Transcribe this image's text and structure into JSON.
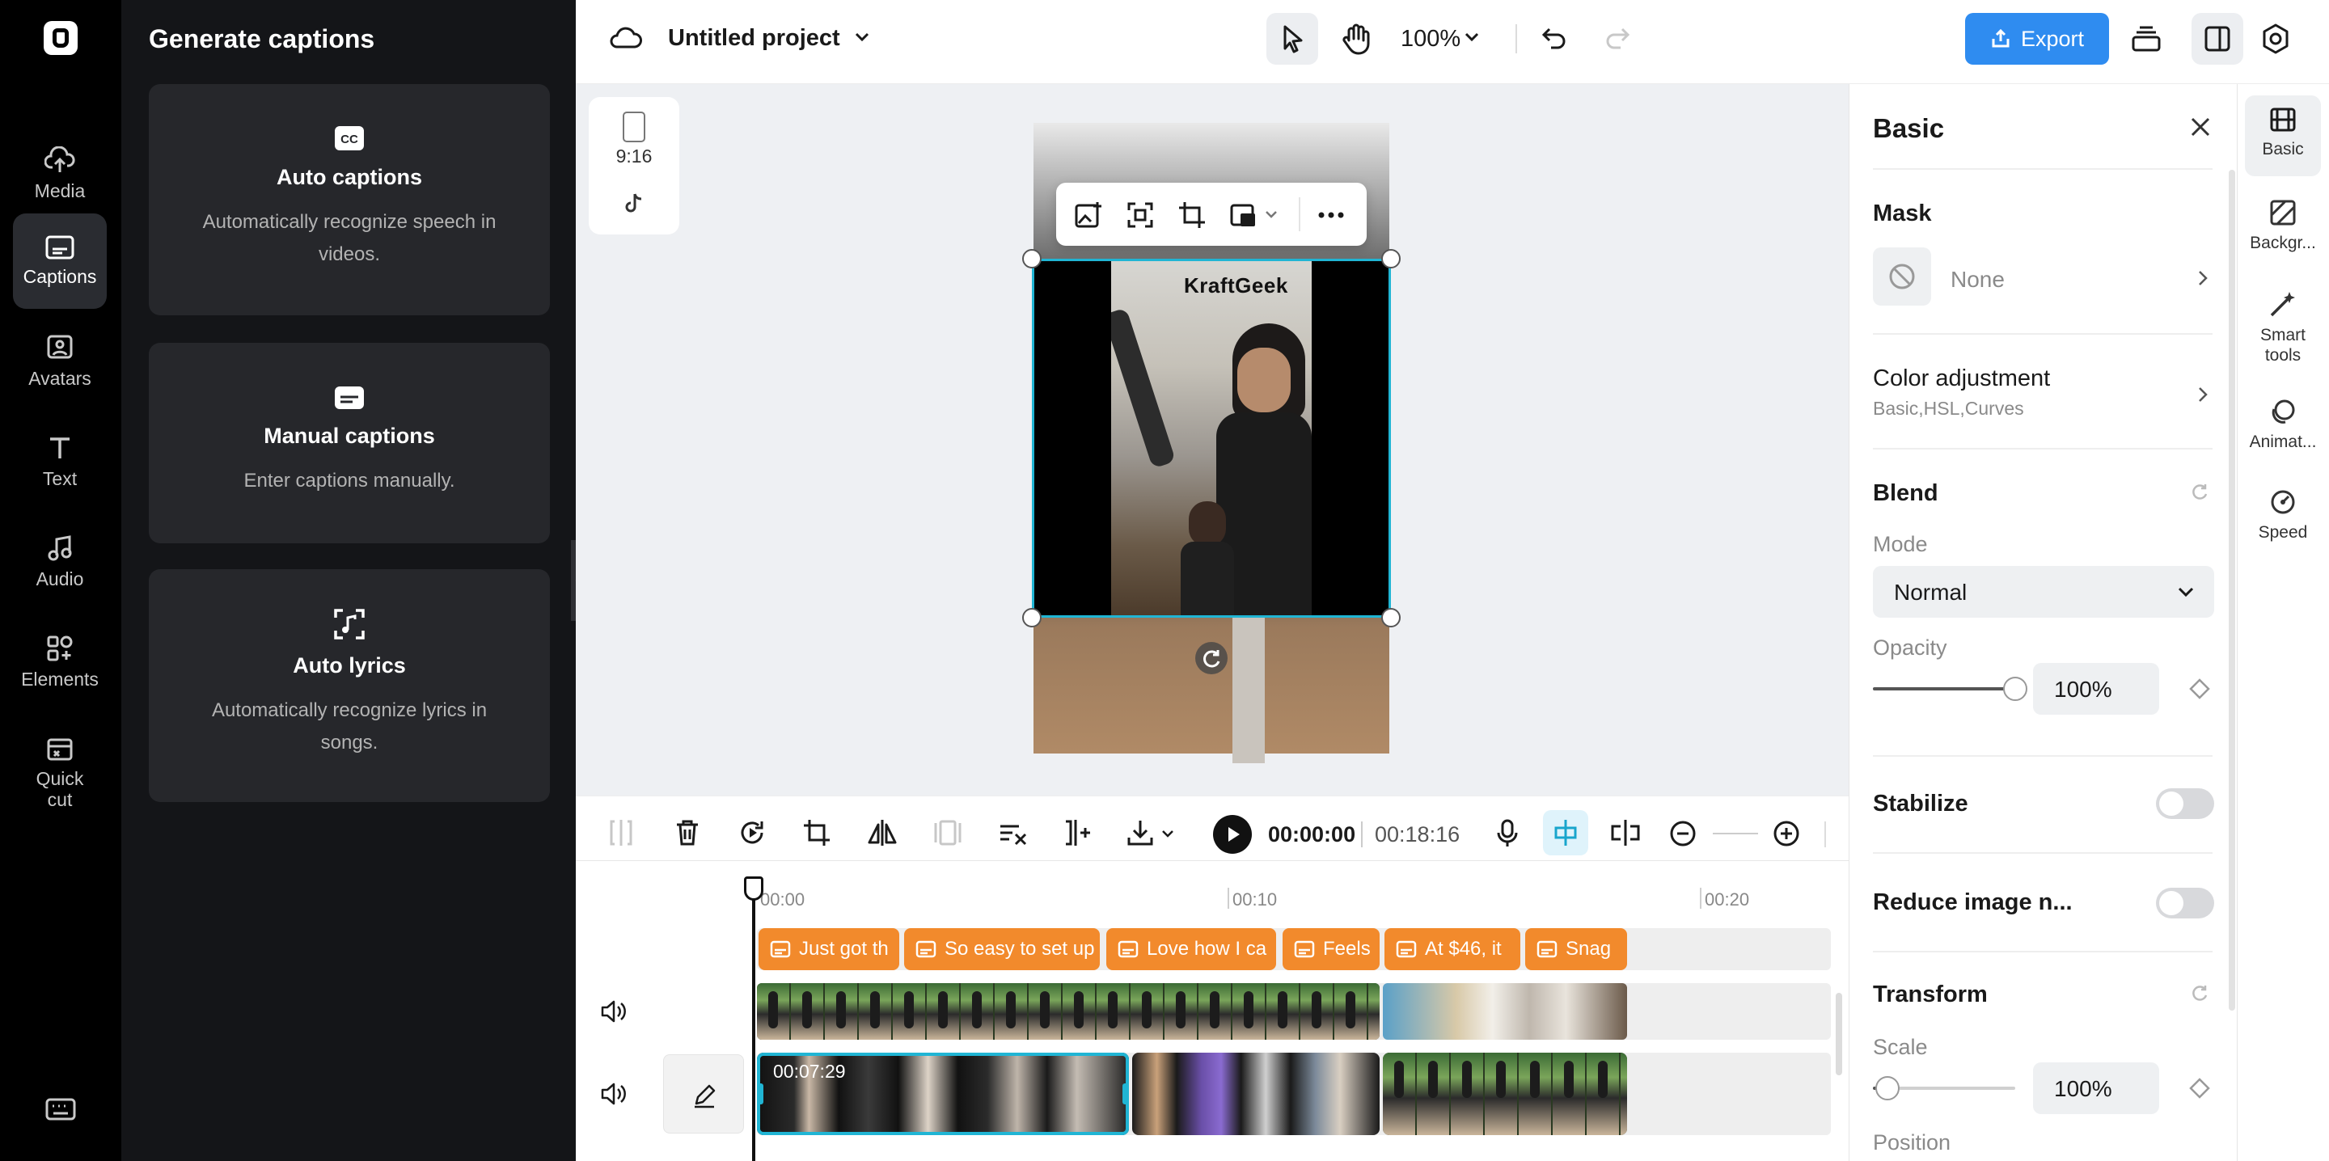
{
  "app": {
    "project_title": "Untitled project",
    "zoom": "100%",
    "export_label": "Export"
  },
  "rail": {
    "items": [
      {
        "label": "Media",
        "icon": "cloud-upload-icon"
      },
      {
        "label": "Captions",
        "icon": "captions-icon",
        "active": true
      },
      {
        "label": "Avatars",
        "icon": "avatar-icon"
      },
      {
        "label": "Text",
        "icon": "text-icon"
      },
      {
        "label": "Audio",
        "icon": "music-icon"
      },
      {
        "label": "Elements",
        "icon": "elements-icon"
      },
      {
        "label": "Quick cut",
        "icon": "quick-cut-icon"
      }
    ]
  },
  "panel": {
    "title": "Generate captions",
    "cards": [
      {
        "title": "Auto captions",
        "desc": "Automatically recognize speech in videos.",
        "icon": "cc-icon"
      },
      {
        "title": "Manual captions",
        "desc": "Enter captions manually.",
        "icon": "subtitle-icon"
      },
      {
        "title": "Auto lyrics",
        "desc": "Automatically recognize lyrics in songs.",
        "icon": "lyrics-icon"
      }
    ]
  },
  "canvas": {
    "ratio_label": "9:16",
    "watermark": "KraftGeek"
  },
  "right_panel": {
    "title": "Basic",
    "mask": {
      "label": "Mask",
      "value": "None"
    },
    "color_adjustment": {
      "label": "Color adjustment",
      "sub": "Basic,HSL,Curves"
    },
    "blend": {
      "label": "Blend",
      "mode_label": "Mode",
      "mode_value": "Normal",
      "opacity_label": "Opacity",
      "opacity_value": "100%",
      "opacity_level": 1.0
    },
    "stabilize": {
      "label": "Stabilize",
      "on": false
    },
    "reduce_noise": {
      "label": "Reduce image n...",
      "on": false
    },
    "transform": {
      "label": "Transform",
      "scale_label": "Scale",
      "scale_value": "100%",
      "scale_level": 0.1,
      "position_label": "Position"
    }
  },
  "right_tabs": [
    {
      "label": "Basic",
      "icon": "film-icon"
    },
    {
      "label": "Backgr...",
      "icon": "background-icon"
    },
    {
      "label": "Smart tools",
      "icon": "magic-wand-icon"
    },
    {
      "label": "Animat...",
      "icon": "animation-icon"
    },
    {
      "label": "Speed",
      "icon": "speed-icon"
    }
  ],
  "timeline": {
    "current_time": "00:00:00",
    "total_time": "00:18:16",
    "ruler": [
      "00:00",
      "00:10",
      "00:20"
    ],
    "captions": [
      "Just got th",
      "So easy to set up",
      "Love how I ca",
      "Feels",
      "At $46, it",
      "Snag"
    ],
    "selected_clip_time": "00:07:29"
  }
}
